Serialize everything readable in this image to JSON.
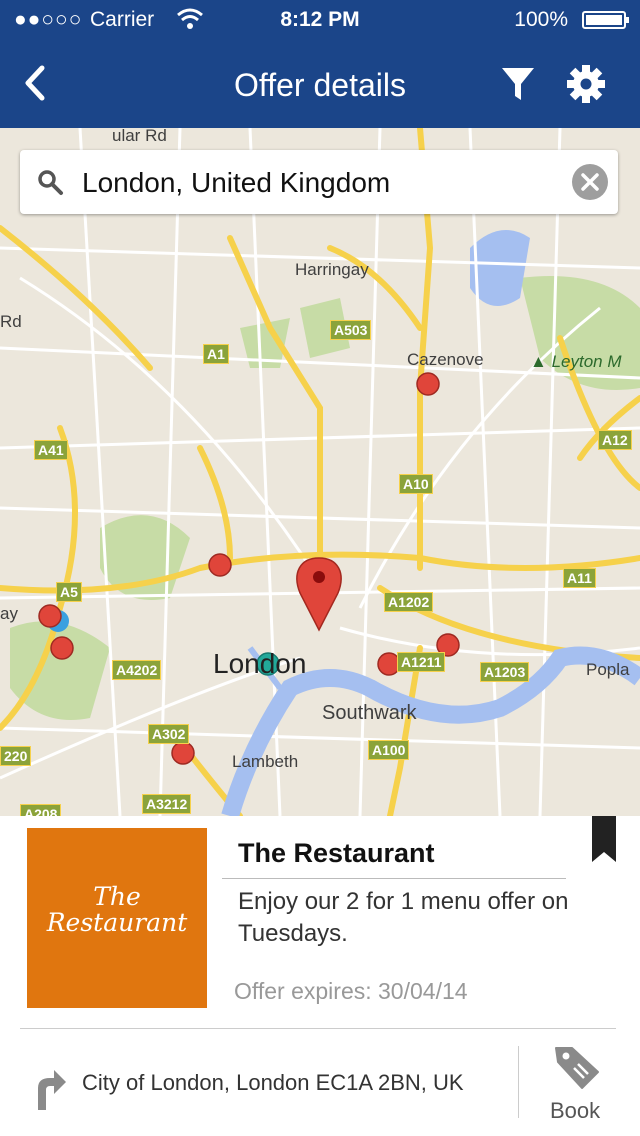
{
  "status_bar": {
    "signal": "●●○○○",
    "carrier": "Carrier",
    "time": "8:12 PM",
    "battery": "100%"
  },
  "nav": {
    "title": "Offer details",
    "icons": [
      "back-chevron-icon",
      "filter-icon",
      "gear-icon"
    ]
  },
  "search": {
    "value": "London, United Kingdom",
    "icons": [
      "search-icon",
      "clear-icon"
    ]
  },
  "map": {
    "place_labels": [
      "Harringay",
      "Cazenove",
      "Leyton M",
      "London",
      "Southwark",
      "Lambeth",
      "Popla",
      "ular Rd",
      "Rd",
      "ay"
    ],
    "road_labels": [
      "A503",
      "A1",
      "A41",
      "A10",
      "A12",
      "A5",
      "A1202",
      "A11",
      "A4202",
      "A1211",
      "A1203",
      "A302",
      "A100",
      "220",
      "A3212",
      "A208"
    ],
    "markers": {
      "selected": "red pin",
      "others": 10,
      "highlight": 1
    }
  },
  "offer": {
    "thumbnail_text": "The Restaurant",
    "name": "The Restaurant",
    "description": "Enjoy our 2 for 1 menu offer on Tuesdays.",
    "expires": "Offer expires: 30/04/14",
    "address": "City of London, London EC1A 2BN, UK",
    "book_label": "Book"
  },
  "colors": {
    "nav_bar": "#1b4589",
    "thumb_bg": "#e0760f",
    "road_major": "#f6d14b",
    "marker": "#e0453a"
  }
}
